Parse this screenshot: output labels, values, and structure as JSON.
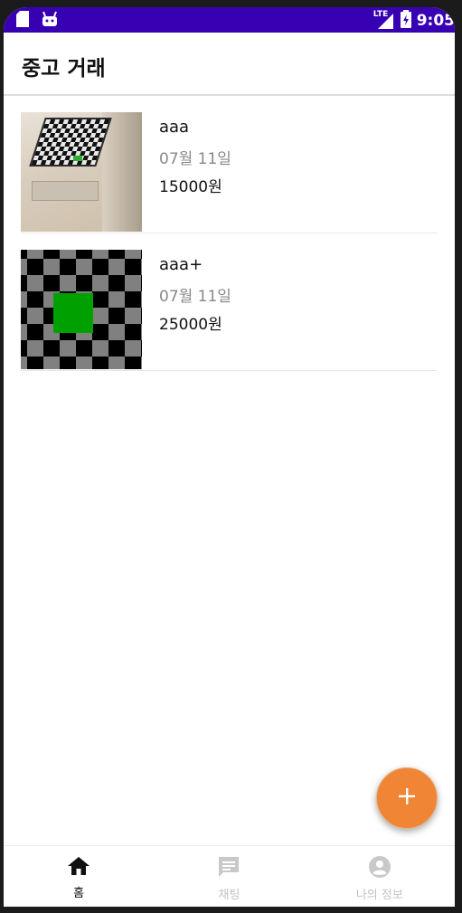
{
  "status_bar": {
    "network_label": "LTE",
    "time": "9:05"
  },
  "appbar": {
    "title": "중고 거래"
  },
  "items": [
    {
      "title": "aaa",
      "date": "07월 11일",
      "price": "15000원"
    },
    {
      "title": "aaa+",
      "date": "07월 11일",
      "price": "25000원"
    }
  ],
  "fab": {
    "icon": "plus-icon"
  },
  "bottom_nav": {
    "items": [
      {
        "label": "홈",
        "icon": "home-icon",
        "active": true
      },
      {
        "label": "채팅",
        "icon": "chat-icon",
        "active": false
      },
      {
        "label": "나의 정보",
        "icon": "account-circle-icon",
        "active": false
      }
    ]
  },
  "colors": {
    "status_bar": "#3700b3",
    "fab": "#f08535",
    "active_nav": "#111111",
    "inactive_nav": "#c2c2c2",
    "secondary_text": "#888888"
  }
}
